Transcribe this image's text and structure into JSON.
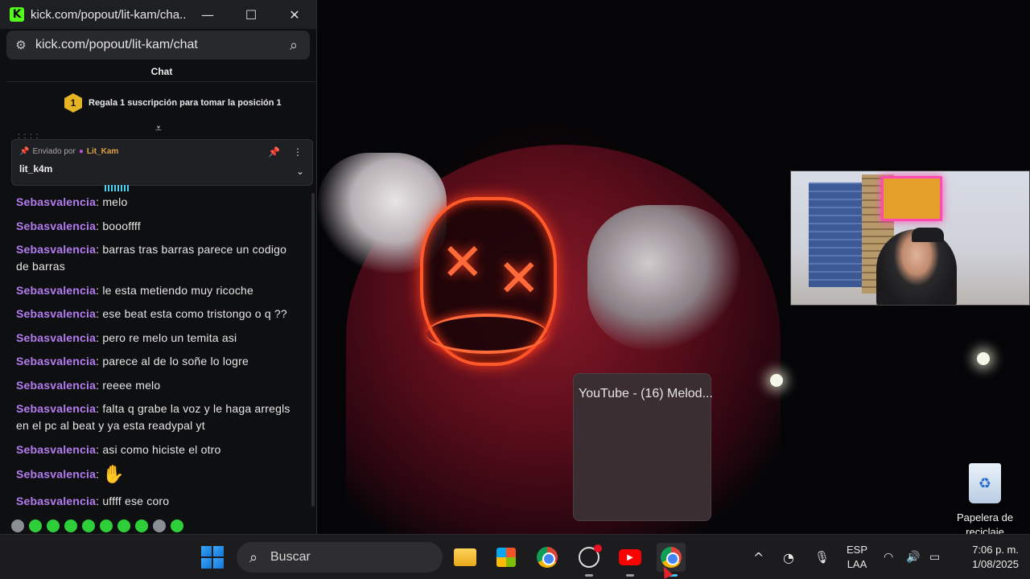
{
  "window": {
    "title": "kick.com/popout/lit-kam/cha...",
    "url": "kick.com/popout/lit-kam/chat",
    "minimize_glyph": "—",
    "maximize_glyph": "☐",
    "close_glyph": "✕"
  },
  "chat": {
    "header": "Chat",
    "sub_banner": {
      "badge": "1",
      "text": "Regala 1 suscripción para tomar la posición 1"
    },
    "dots": ": : : :",
    "pinned": {
      "sent_by_label": "Enviado por",
      "sent_by_user": "Lit_Kam",
      "message": "lit_k4m"
    },
    "messages": [
      {
        "user": "Sebasvalencia",
        "text": "melo"
      },
      {
        "user": "Sebasvalencia",
        "text": "boooffff"
      },
      {
        "user": "Sebasvalencia",
        "text": "barras tras barras parece un codigo de barras"
      },
      {
        "user": "Sebasvalencia",
        "text": "le esta metiendo muy ricoche"
      },
      {
        "user": "Sebasvalencia",
        "text": "ese beat esta como tristongo o q ??"
      },
      {
        "user": "Sebasvalencia",
        "text": "pero re melo un temita asi"
      },
      {
        "user": "Sebasvalencia",
        "text": "parece al de lo soñe lo logre"
      },
      {
        "user": "Sebasvalencia",
        "text": "reeee melo"
      },
      {
        "user": "Sebasvalencia",
        "text": "falta q grabe la voz y le haga arregls en el pc al beat y ya esta readypal yt"
      },
      {
        "user": "Sebasvalencia",
        "text": "asi como hiciste el otro"
      },
      {
        "user": "Sebasvalencia",
        "text": "",
        "emote": "hands-emote"
      },
      {
        "user": "Sebasvalencia",
        "text": "uffff ese coro"
      }
    ]
  },
  "youtube_preview": {
    "title": "YouTube - (16) Melod..."
  },
  "desktop": {
    "recycle_bin_label": "Papelera de reciclaje"
  },
  "taskbar": {
    "search_placeholder": "Buscar",
    "language": "ESP",
    "layout": "LAA",
    "time": "7:06 p. m.",
    "date": "1/08/2025",
    "icons": {
      "tray_expand": "^",
      "mic": "🎙",
      "wifi": "wifi",
      "volume": "🔊",
      "battery": "battery"
    }
  },
  "colors": {
    "kick_green": "#53fc18",
    "username_purple": "#b47cf0",
    "pinned_user": "#e0a040",
    "badge_gold": "#e6b422"
  }
}
